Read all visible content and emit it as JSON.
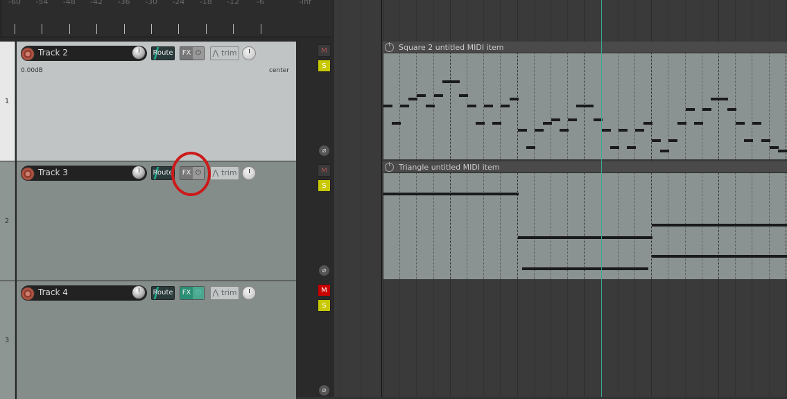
{
  "meter": {
    "labels": [
      "-60",
      "-54",
      "-48",
      "-42",
      "-36",
      "-30",
      "-24",
      "-18",
      "-12",
      "-6",
      "-inf"
    ]
  },
  "tracks": [
    {
      "number": "1",
      "name": "Track 2",
      "route": "Route",
      "fx": "FX",
      "fx_power": "⏻",
      "trim": "trim",
      "volume": "0.00dB",
      "pan": "center",
      "mute": "M",
      "solo": "S",
      "phase": "⌀",
      "selected": true,
      "fx_active": false,
      "muted": false
    },
    {
      "number": "2",
      "name": "Track 3",
      "route": "Route",
      "fx": "FX",
      "fx_power": "⏻",
      "trim": "trim",
      "mute": "M",
      "solo": "S",
      "phase": "⌀",
      "selected": false,
      "fx_active": false,
      "muted": false
    },
    {
      "number": "3",
      "name": "Track 4",
      "route": "Route",
      "fx": "FX",
      "fx_power": "⏻",
      "trim": "trim",
      "mute": "M",
      "solo": "S",
      "phase": "⌀",
      "selected": false,
      "fx_active": true,
      "muted": true
    }
  ],
  "items": [
    {
      "title": "Square 2 untitled MIDI item",
      "notes": [
        [
          0,
          1,
          13
        ],
        [
          1,
          1,
          8
        ],
        [
          2,
          1,
          13
        ],
        [
          3,
          1,
          15
        ],
        [
          4,
          1,
          16
        ],
        [
          5,
          1,
          13
        ],
        [
          6,
          1,
          16
        ],
        [
          7,
          2,
          20
        ],
        [
          9,
          1,
          16
        ],
        [
          10,
          1,
          13
        ],
        [
          11,
          1,
          8
        ],
        [
          12,
          1,
          13
        ],
        [
          13,
          1,
          8
        ],
        [
          14,
          1,
          13
        ],
        [
          15,
          1,
          15
        ],
        [
          16,
          1,
          6
        ],
        [
          17,
          1,
          1
        ],
        [
          18,
          1,
          6
        ],
        [
          19,
          1,
          8
        ],
        [
          20,
          1,
          9
        ],
        [
          21,
          1,
          6
        ],
        [
          22,
          1,
          9
        ],
        [
          23,
          2,
          13
        ],
        [
          25,
          1,
          9
        ],
        [
          26,
          1,
          6
        ],
        [
          27,
          1,
          1
        ],
        [
          28,
          1,
          6
        ],
        [
          29,
          1,
          1
        ],
        [
          30,
          1,
          6
        ],
        [
          31,
          1,
          8
        ],
        [
          32,
          1,
          3
        ],
        [
          33,
          1,
          0
        ],
        [
          34,
          1,
          3
        ],
        [
          35,
          1,
          8
        ],
        [
          36,
          1,
          12
        ],
        [
          37,
          1,
          8
        ],
        [
          38,
          1,
          12
        ],
        [
          39,
          2,
          15
        ],
        [
          41,
          1,
          12
        ],
        [
          42,
          1,
          8
        ],
        [
          43,
          1,
          3
        ],
        [
          44,
          1,
          8
        ],
        [
          45,
          1,
          3
        ],
        [
          46,
          1,
          1
        ],
        [
          47,
          1,
          0
        ]
      ]
    },
    {
      "title": "Triangle untitled MIDI item",
      "notes": [
        [
          0,
          16,
          24
        ],
        [
          16,
          16,
          10
        ],
        [
          16.5,
          15,
          0
        ],
        [
          32,
          16,
          14
        ],
        [
          32,
          16,
          4
        ]
      ]
    }
  ],
  "annotation": {
    "highlight": "fx-button-track-3",
    "color": "#cc1a1a"
  },
  "colors": {
    "playhead": "#3aa898",
    "solo": "#c8c800",
    "mute_on": "#c80000"
  }
}
